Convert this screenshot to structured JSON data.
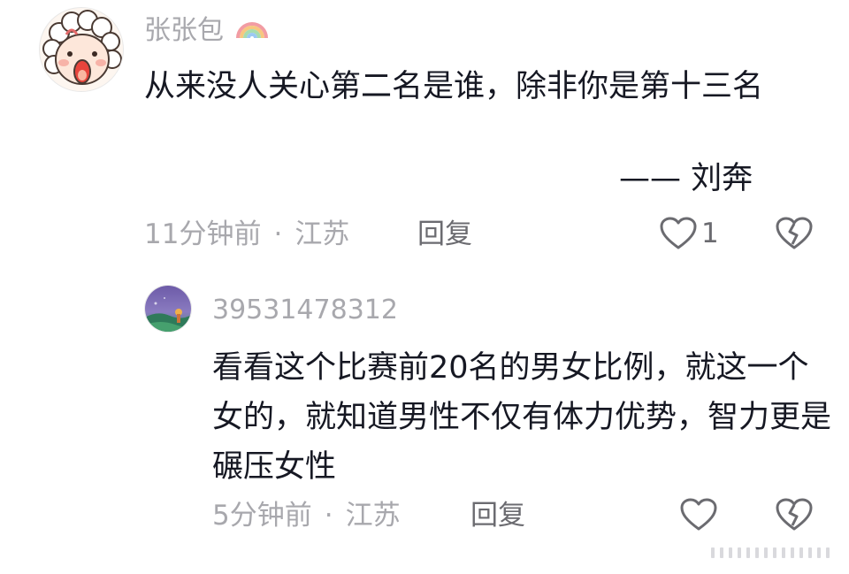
{
  "comments": [
    {
      "username": "张张包",
      "content": "从来没人关心第二名是谁，除非你是第十三名",
      "signature": "—— 刘奔",
      "time": "11分钟前",
      "separator": "·",
      "location": "江苏",
      "reply_label": "回复",
      "like_count": "1",
      "avatar_icon": "cartoon-sheep-avatar",
      "badge_icon": "rainbow-icon"
    },
    {
      "username": "39531478312",
      "content": "看看这个比赛前20名的男女比例，就这一个女的，就知道男性不仅有体力优势，智力更是碾压女性",
      "time": "5分钟前",
      "separator": "·",
      "location": "江苏",
      "reply_label": "回复",
      "like_count": "",
      "avatar_icon": "landscape-photo-avatar"
    }
  ],
  "colors": {
    "text_primary": "#161823",
    "text_secondary": "#a8a8ad",
    "icon_gray": "#6b6b70"
  }
}
